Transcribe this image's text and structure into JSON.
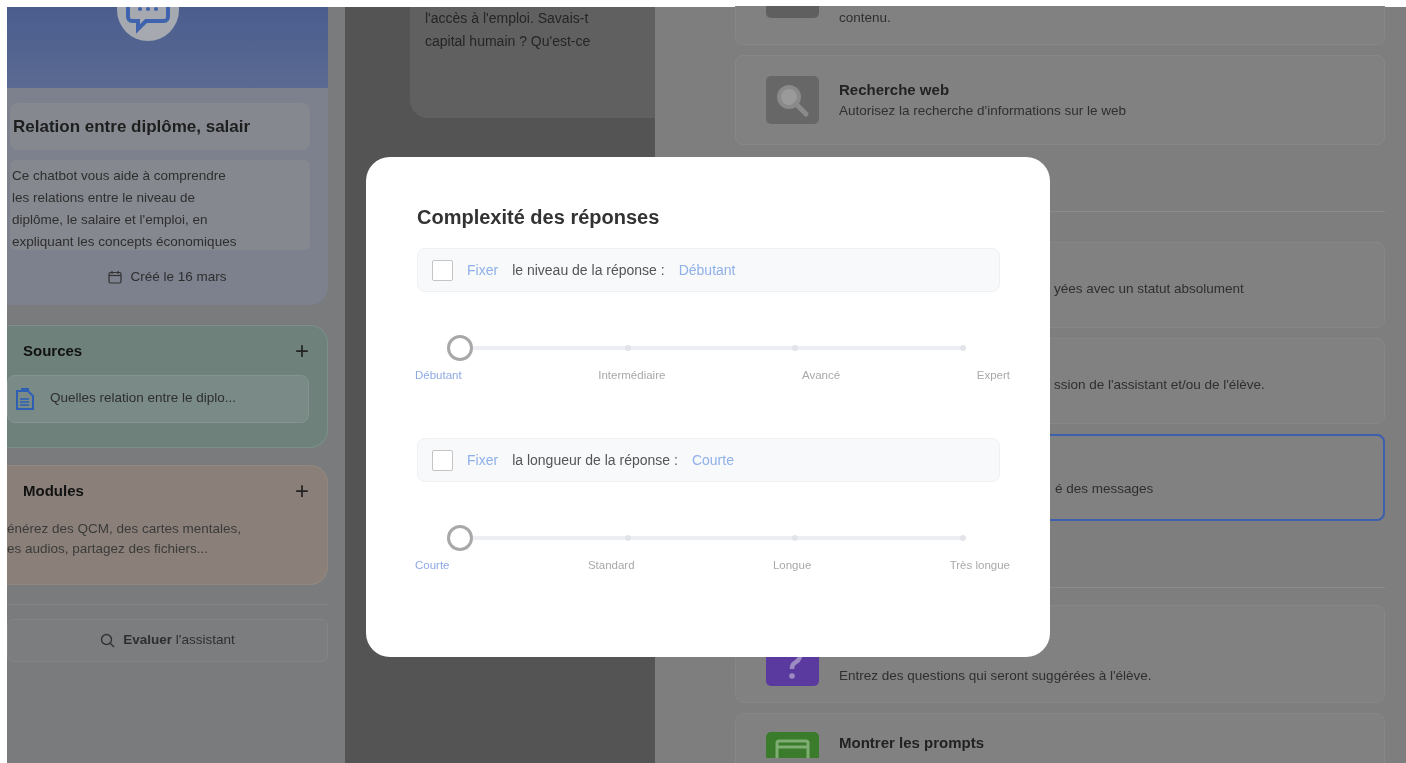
{
  "left_panel": {
    "assistant": {
      "title": "Relation entre diplôme, salair",
      "description_lines": [
        "Ce chatbot vous aide à comprendre",
        "les relations entre le niveau de",
        "diplôme, le salaire et l'emploi, en",
        "expliquant les concepts économiques"
      ],
      "created": "Créé le 16 mars"
    },
    "sources": {
      "title": "Sources",
      "add_label": "+",
      "items": [
        "Quelles relation entre le diplo..."
      ]
    },
    "modules": {
      "title": "Modules",
      "add_label": "+",
      "description_lines": [
        "énérez des QCM, des cartes mentales,",
        "es audios, partagez des fichiers..."
      ]
    },
    "evaluate_button": "**Evaluer** l'assistant"
  },
  "chat_preview": {
    "lines": [
      "l'accès à l'emploi. Savais-t",
      "capital humain ? Qu'est-ce"
    ]
  },
  "settings_groups": [
    [
      {
        "kind": "content",
        "description": "contenu.",
        "selected": false
      },
      {
        "kind": "web_search",
        "title": "Recherche web",
        "description": "Autorisez la recherche d'informations sur le web",
        "selected": false
      }
    ],
    [
      {
        "kind": "hidden",
        "description": "yées avec un statut absolument",
        "selected": false
      },
      {
        "kind": "hidden",
        "description": "ssion de l'assistant et/ou de l'élève.",
        "selected": false
      },
      {
        "kind": "hidden",
        "description": "é des messages",
        "selected": true
      }
    ],
    [
      {
        "kind": "suggestions",
        "description": "Entrez des questions qui seront suggérées à l'élève.",
        "selected": false
      },
      {
        "kind": "prompts",
        "title": "Montrer les prompts",
        "selected": false
      }
    ]
  ],
  "modal": {
    "title": "Complexité des réponses",
    "settings": [
      {
        "checked": false,
        "fix_label": "Fixer",
        "label": "le niveau de la réponse :",
        "value": "Débutant",
        "slider": {
          "level": 0,
          "stops": [
            {
              "label": "Débutant",
              "selected": true
            },
            {
              "label": "Intermédiaire",
              "selected": false
            },
            {
              "label": "Avancé",
              "selected": false
            },
            {
              "label": "Expert",
              "selected": false
            }
          ]
        }
      },
      {
        "checked": false,
        "fix_label": "Fixer",
        "label": "la longueur de la réponse :",
        "value": "Courte",
        "slider": {
          "level": 0,
          "stops": [
            {
              "label": "Courte",
              "selected": true
            },
            {
              "label": "Standard",
              "selected": false
            },
            {
              "label": "Longue",
              "selected": false
            },
            {
              "label": "Très longue",
              "selected": false
            }
          ]
        }
      }
    ]
  }
}
